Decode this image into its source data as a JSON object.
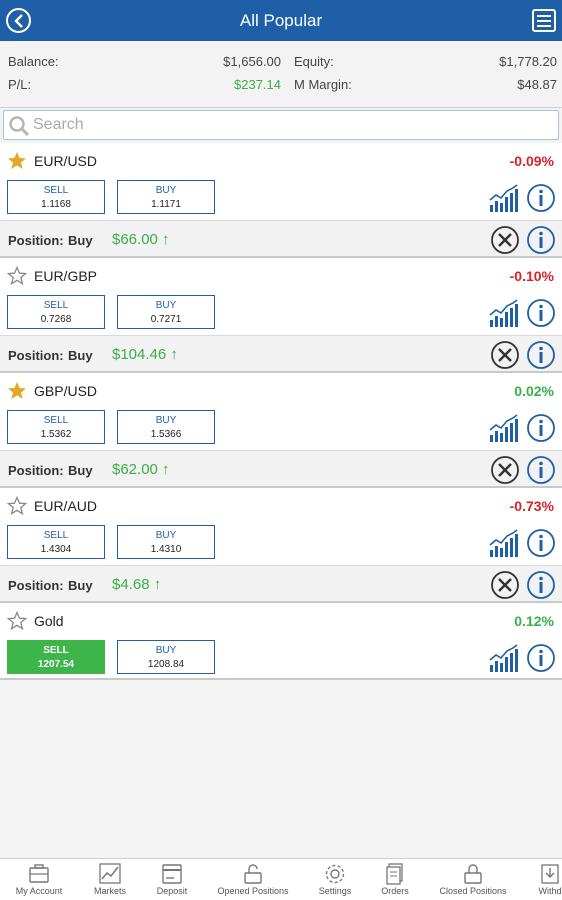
{
  "header": {
    "title": "All Popular"
  },
  "account": {
    "balance_label": "Balance:",
    "balance_value": "$1,656.00",
    "equity_label": "Equity:",
    "equity_value": "$1,778.20",
    "pl_label": "P/L:",
    "pl_value": "$237.14",
    "margin_label": "M Margin:",
    "margin_value": "$48.87"
  },
  "search": {
    "placeholder": "Search"
  },
  "instruments": [
    {
      "symbol": "EUR/USD",
      "change": "-0.09%",
      "starred": true,
      "sell_label": "SELL",
      "sell": "1.1168",
      "buy_label": "BUY",
      "buy": "1.1171",
      "position": {
        "label": "Position:",
        "side": "Buy",
        "pl": "$66.00 ↑"
      }
    },
    {
      "symbol": "EUR/GBP",
      "change": "-0.10%",
      "starred": false,
      "sell_label": "SELL",
      "sell": "0.7268",
      "buy_label": "BUY",
      "buy": "0.7271",
      "position": {
        "label": "Position:",
        "side": "Buy",
        "pl": "$104.46 ↑"
      }
    },
    {
      "symbol": "GBP/USD",
      "change": "0.02%",
      "starred": true,
      "sell_label": "SELL",
      "sell": "1.5362",
      "buy_label": "BUY",
      "buy": "1.5366",
      "position": {
        "label": "Position:",
        "side": "Buy",
        "pl": "$62.00 ↑"
      }
    },
    {
      "symbol": "EUR/AUD",
      "change": "-0.73%",
      "starred": false,
      "sell_label": "SELL",
      "sell": "1.4304",
      "buy_label": "BUY",
      "buy": "1.4310",
      "position": {
        "label": "Position:",
        "side": "Buy",
        "pl": "$4.68 ↑"
      }
    },
    {
      "symbol": "Gold",
      "change": "0.12%",
      "starred": false,
      "sell_label": "SELL",
      "sell": "1207.54",
      "buy_label": "BUY",
      "buy": "1208.84",
      "sell_active": true
    }
  ],
  "bottom_tabs": [
    {
      "label": "My Account",
      "icon": "briefcase-icon"
    },
    {
      "label": "Markets",
      "icon": "chart-icon"
    },
    {
      "label": "Deposit",
      "icon": "card-icon"
    },
    {
      "label": "Opened Positions",
      "icon": "unlock-icon"
    },
    {
      "label": "Settings",
      "icon": "gear-icon"
    },
    {
      "label": "Orders",
      "icon": "document-icon"
    },
    {
      "label": "Closed Positions",
      "icon": "lock-icon"
    },
    {
      "label": "Withd",
      "icon": "withdraw-icon"
    }
  ],
  "colors": {
    "brand": "#1f5fa8",
    "positive": "#3aae49",
    "negative": "#d6222a",
    "star": "#e4a826"
  }
}
